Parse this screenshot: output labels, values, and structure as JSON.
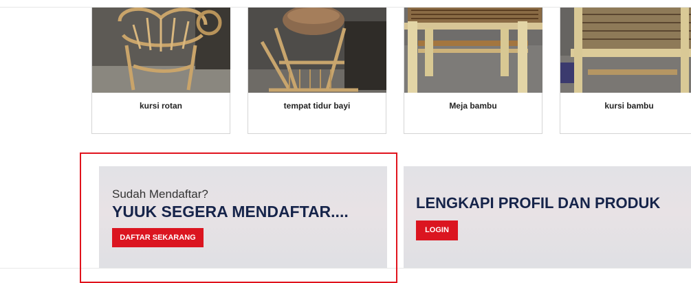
{
  "products": [
    {
      "name": "kursi rotan",
      "image": "rattan-chair-photo"
    },
    {
      "name": "tempat tidur bayi",
      "image": "baby-bed-photo"
    },
    {
      "name": "Meja bambu",
      "image": "bamboo-table-photo"
    },
    {
      "name": "kursi bambu",
      "image": "bamboo-chair-photo"
    }
  ],
  "register_banner": {
    "eyebrow": "Sudah Mendaftar?",
    "headline": "YUUK SEGERA MENDAFTAR....",
    "button": "DAFTAR SEKARANG"
  },
  "profile_banner": {
    "headline": "LENGKAPI PROFIL DAN PRODUK",
    "button": "LOGIN"
  },
  "colors": {
    "accent": "#db1520",
    "headline": "#16244a",
    "highlight_border": "#e0121c"
  }
}
